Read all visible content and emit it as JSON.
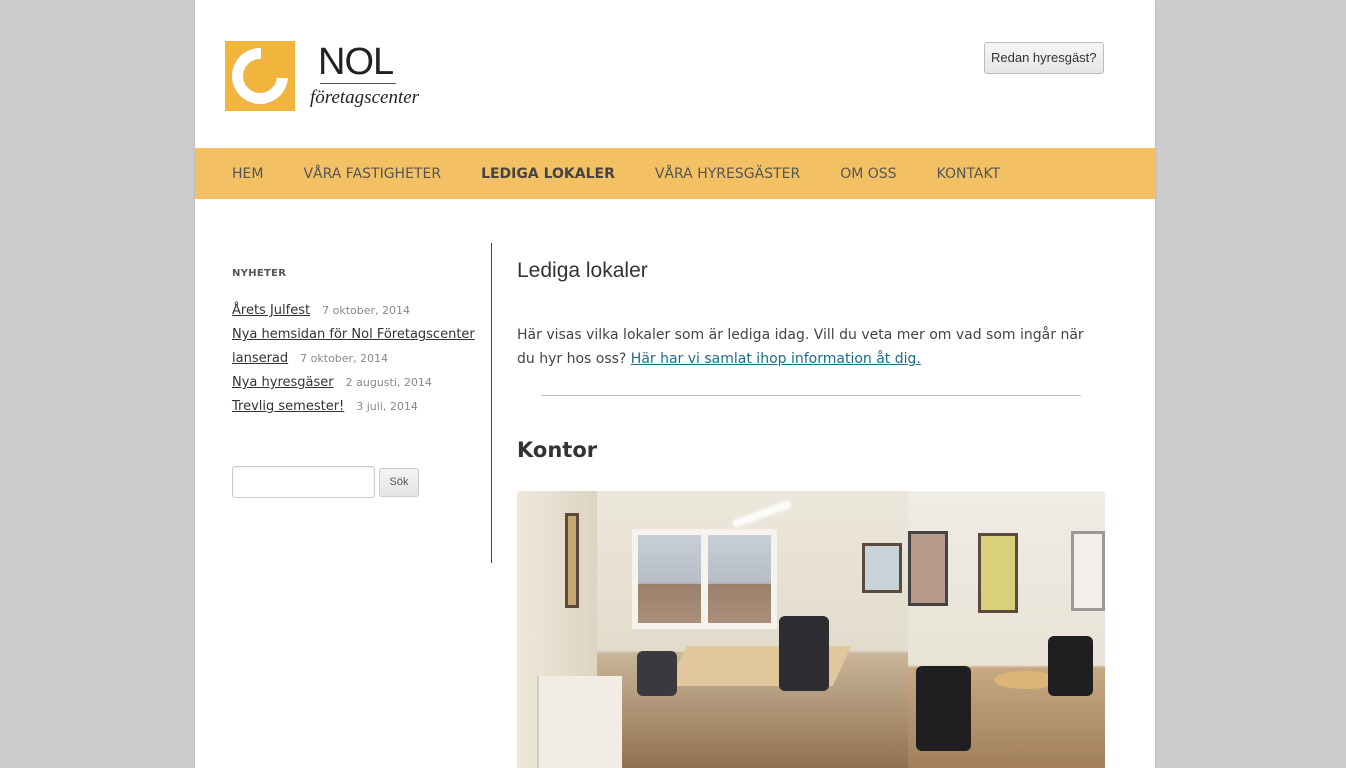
{
  "header": {
    "logo_name": "NOL",
    "logo_subtitle": "företagscenter",
    "tenant_button": "Redan hyresgäst?"
  },
  "nav": {
    "items": [
      {
        "label": "HEM"
      },
      {
        "label": "VÅRA FASTIGHETER"
      },
      {
        "label": "LEDIGA LOKALER",
        "active": true
      },
      {
        "label": "VÅRA HYRESGÄSTER"
      },
      {
        "label": "OM OSS"
      },
      {
        "label": "KONTAKT"
      }
    ]
  },
  "sidebar": {
    "news_title": "NYHETER",
    "news": [
      {
        "title": "Årets Julfest",
        "date": "7 oktober, 2014"
      },
      {
        "title": "Nya hemsidan för Nol Företagscenter lanserad",
        "date": "7 oktober, 2014"
      },
      {
        "title": "Nya hyresgäser",
        "date": "2 augusti, 2014"
      },
      {
        "title": "Trevlig semester!",
        "date": "3 juli, 2014"
      }
    ],
    "search_button": "Sök",
    "search_value": ""
  },
  "content": {
    "title": "Lediga lokaler",
    "intro_text": "Här visas vilka lokaler som är lediga idag. Vill du veta mer om vad som ingår när du hyr hos oss? ",
    "intro_link": "Här har vi samlat ihop information åt dig.",
    "section_heading": "Kontor"
  },
  "colors": {
    "accent": "#f3c163",
    "logo": "#f1b53d",
    "link": "#1e6b8a"
  }
}
